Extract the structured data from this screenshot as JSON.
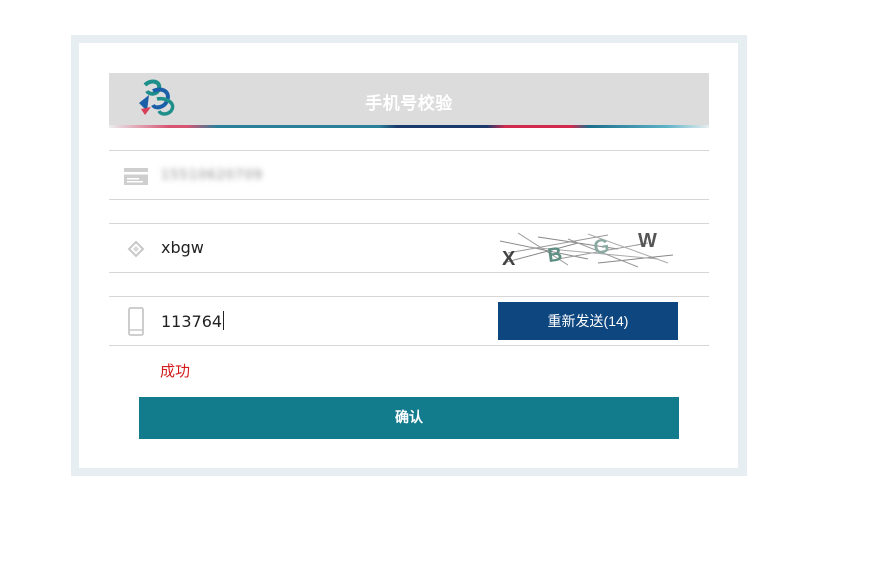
{
  "header": {
    "title": "手机号校验",
    "logo_icon": "bank-logo-icon"
  },
  "phone_row": {
    "icon": "card-icon",
    "value": "15510620709"
  },
  "captcha_row": {
    "icon": "diamond-icon",
    "value": "xbgw",
    "captcha_text": "XBGW"
  },
  "sms_row": {
    "icon": "mobile-phone-icon",
    "value": "113764",
    "resend_label": "重新发送(14)"
  },
  "status": {
    "text": "成功",
    "color": "#d41a1a"
  },
  "confirm_label": "确认",
  "colors": {
    "header_bg": "#dcdcdc",
    "resend_bg": "#0e4680",
    "confirm_bg": "#127b8c",
    "frame_bg": "#e6eef1"
  }
}
